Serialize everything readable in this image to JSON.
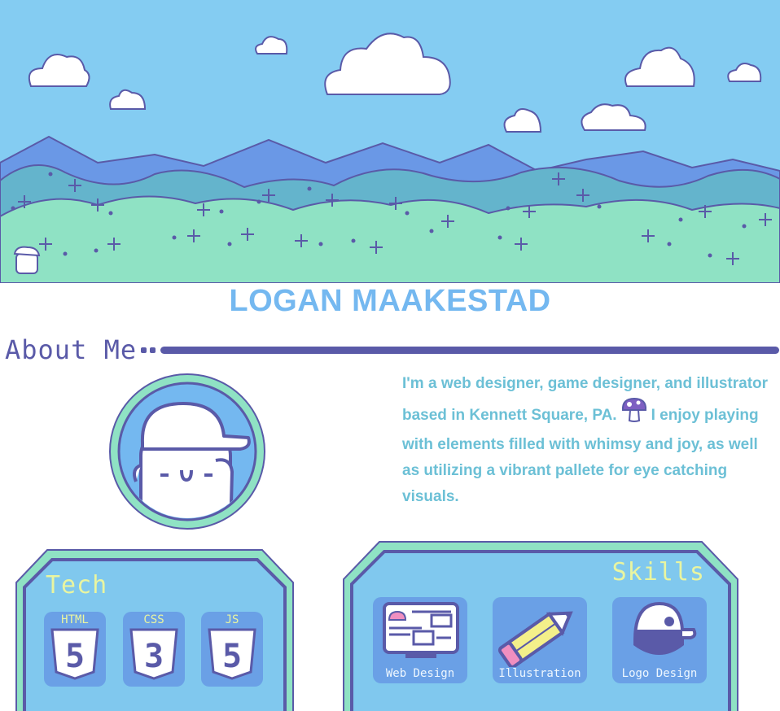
{
  "header": {
    "name": "LOGAN MAAKESTAD"
  },
  "about": {
    "heading": "About Me",
    "bio_part1": "I'm a web designer, game designer, and illustrator based in Kennett Square, PA.",
    "bio_part2": "I enjoy playing with elements filled with whimsy and joy, as well as utilizing a vibrant pallete for eye catching visuals."
  },
  "tech": {
    "title": "Tech",
    "items": [
      {
        "label": "HTML",
        "digit": "5"
      },
      {
        "label": "CSS",
        "digit": "3"
      },
      {
        "label": "JS",
        "digit": "5"
      }
    ]
  },
  "skills": {
    "title": "Skills",
    "items": [
      {
        "label": "Web Design",
        "icon": "monitor-icon"
      },
      {
        "label": "Illustration",
        "icon": "pencil-icon"
      },
      {
        "label": "Logo Design",
        "icon": "cap-icon"
      }
    ]
  },
  "colors": {
    "sky": "#84ccf2",
    "accent": "#5a5aa8",
    "name": "#74b8f0",
    "hills": "#8fe2c4",
    "bio_text": "#6cc0d6",
    "panel_fill": "#80c8ee",
    "panel_border": "#8fe2c4",
    "panel_title": "#e9f5a0"
  }
}
